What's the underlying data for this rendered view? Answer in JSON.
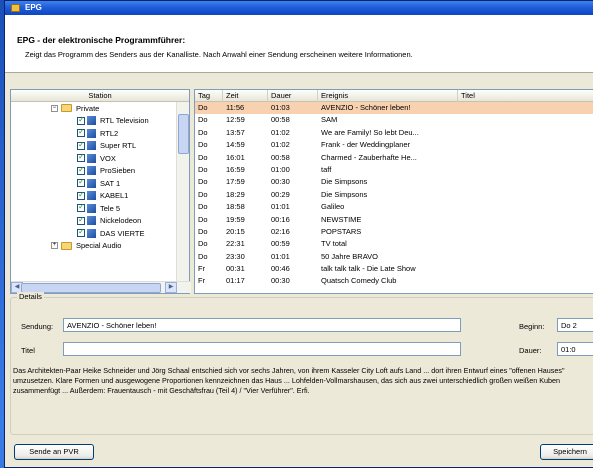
{
  "window": {
    "title": "EPG"
  },
  "header": {
    "title": "EPG - der elektronische Programmführer:",
    "subtitle": "Zeigt das Programm des Senders aus der Kanalliste. Nach Anwahl einer Sendung erscheinen weitere Informationen."
  },
  "tree": {
    "column": "Station",
    "group": "Private",
    "stations": [
      "RTL Television",
      "RTL2",
      "Super RTL",
      "VOX",
      "ProSieben",
      "SAT 1",
      "KABEL1",
      "Tele 5",
      "Nickelodeon",
      "DAS VIERTE"
    ],
    "next_group": "Special Audio"
  },
  "grid": {
    "columns": {
      "tag": "Tag",
      "zeit": "Zeit",
      "dauer": "Dauer",
      "ereignis": "Ereignis",
      "titel": "Titel"
    },
    "rows": [
      {
        "tag": "Do",
        "zeit": "11:56",
        "dauer": "01:03",
        "ereignis": "AVENZIO - Schöner leben!",
        "titel": ""
      },
      {
        "tag": "Do",
        "zeit": "12:59",
        "dauer": "00:58",
        "ereignis": "SAM",
        "titel": ""
      },
      {
        "tag": "Do",
        "zeit": "13:57",
        "dauer": "01:02",
        "ereignis": "We are Family! So lebt Deu...",
        "titel": ""
      },
      {
        "tag": "Do",
        "zeit": "14:59",
        "dauer": "01:02",
        "ereignis": "Frank - der Weddingplaner",
        "titel": ""
      },
      {
        "tag": "Do",
        "zeit": "16:01",
        "dauer": "00:58",
        "ereignis": "Charmed - Zauberhafte He...",
        "titel": ""
      },
      {
        "tag": "Do",
        "zeit": "16:59",
        "dauer": "01:00",
        "ereignis": "taff",
        "titel": ""
      },
      {
        "tag": "Do",
        "zeit": "17:59",
        "dauer": "00:30",
        "ereignis": "Die Simpsons",
        "titel": ""
      },
      {
        "tag": "Do",
        "zeit": "18:29",
        "dauer": "00:29",
        "ereignis": "Die Simpsons",
        "titel": ""
      },
      {
        "tag": "Do",
        "zeit": "18:58",
        "dauer": "01:01",
        "ereignis": "Galileo",
        "titel": ""
      },
      {
        "tag": "Do",
        "zeit": "19:59",
        "dauer": "00:16",
        "ereignis": "NEWSTIME",
        "titel": ""
      },
      {
        "tag": "Do",
        "zeit": "20:15",
        "dauer": "02:16",
        "ereignis": "POPSTARS",
        "titel": ""
      },
      {
        "tag": "Do",
        "zeit": "22:31",
        "dauer": "00:59",
        "ereignis": "TV total",
        "titel": ""
      },
      {
        "tag": "Do",
        "zeit": "23:30",
        "dauer": "01:01",
        "ereignis": "50 Jahre BRAVO",
        "titel": ""
      },
      {
        "tag": "Fr",
        "zeit": "00:31",
        "dauer": "00:46",
        "ereignis": "talk talk talk - Die Late Show",
        "titel": ""
      },
      {
        "tag": "Fr",
        "zeit": "01:17",
        "dauer": "00:30",
        "ereignis": "Quatsch Comedy Club",
        "titel": ""
      }
    ]
  },
  "details": {
    "legend": "Details",
    "sendung_label": "Sendung:",
    "sendung_value": "AVENZIO - Schöner leben!",
    "titel_label": "Titel",
    "titel_value": "",
    "beginn_label": "Beginn:",
    "beginn_value": "Do 2",
    "dauer_label": "Dauer:",
    "dauer_value": "01:0",
    "description": "Das Architekten-Paar Heike Schneider und Jörg Schaal entschied sich vor sechs Jahren, von ihrem Kasseler City Loft aufs Land ... dort ihren Entwurf eines \"offenen Hauses\" umzusetzen. Klare Formen und ausgewogene Proportionen kennzeichnen das Haus ... Lohfelden-Vollmarshausen, das sich aus zwei unterschiedlich großen weißen Kuben zusammenfügt ... Außerdem: Frauentausch - mit Geschäftsfrau (Teil 4) / \"Vier Verführer\". Erfi."
  },
  "buttons": {
    "send_pvr": "Sende an PVR",
    "save": "Speichern"
  }
}
